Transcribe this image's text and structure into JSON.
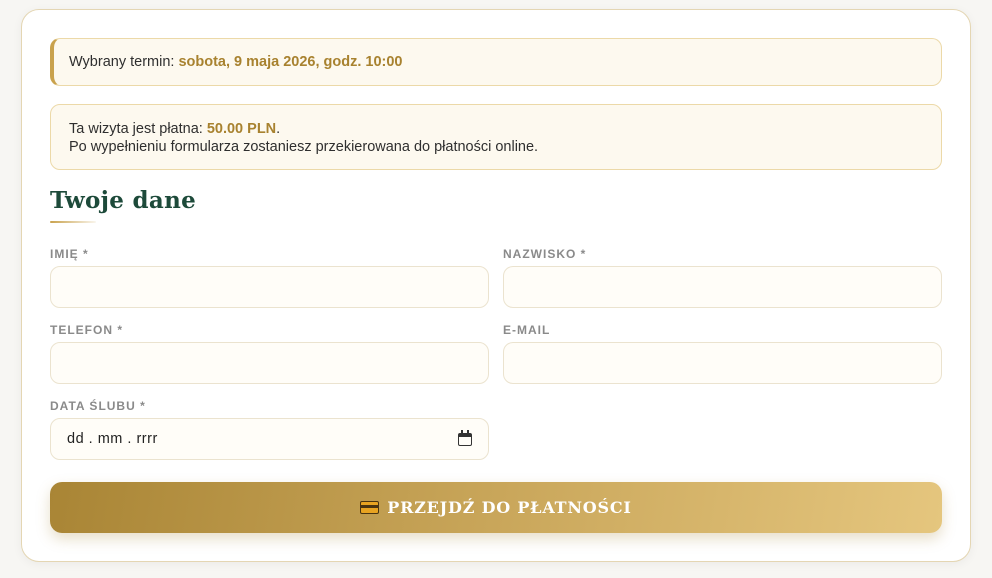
{
  "selected_term": {
    "prefix": "Wybrany termin: ",
    "value": "sobota, 9 maja 2026, godz. 10:00"
  },
  "payment_notice": {
    "prefix": "Ta wizyta jest płatna: ",
    "amount": "50.00 PLN",
    "suffix": ".",
    "line2": "Po wypełnieniu formularza zostaniesz przekierowana do płatności online."
  },
  "form": {
    "title": "Twoje dane",
    "first_name": {
      "label": "IMIĘ *",
      "value": ""
    },
    "last_name": {
      "label": "NAZWISKO *",
      "value": ""
    },
    "phone": {
      "label": "TELEFON *",
      "value": ""
    },
    "email": {
      "label": "E-MAIL",
      "value": ""
    },
    "wedding_date": {
      "label": "DATA ŚLUBU *",
      "placeholder": "dd . mm . rrrr",
      "icon": "calendar-icon"
    },
    "submit": {
      "label": "PRZEJDŹ DO PŁATNOŚCI",
      "icon": "credit-card-icon"
    }
  },
  "colors": {
    "accent_gold": "#c9a24d",
    "highlight_text": "#a8822f",
    "title_green": "#1d4a3a"
  }
}
